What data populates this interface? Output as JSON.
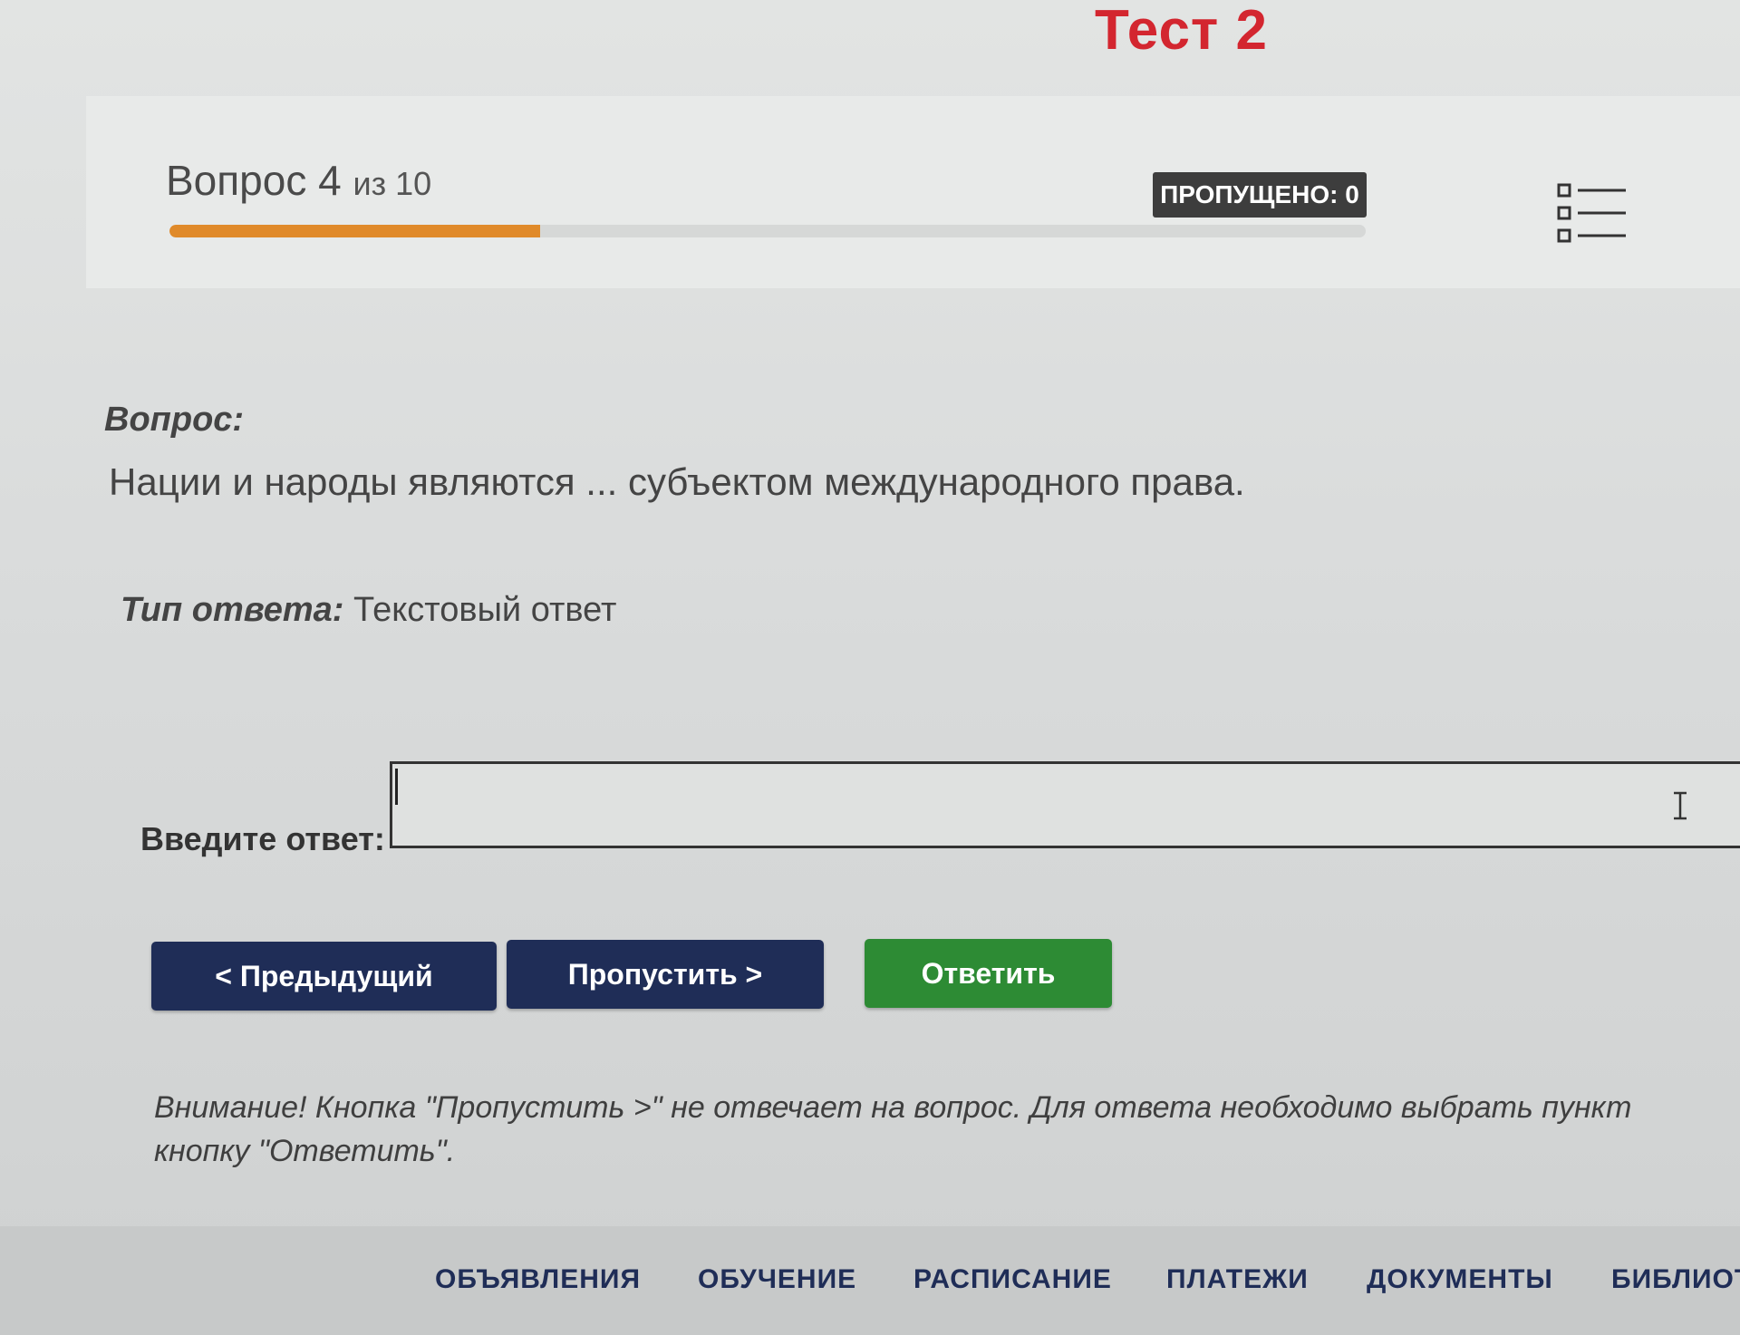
{
  "page": {
    "title": "Тест 2"
  },
  "progress": {
    "counter_prefix": "Вопрос 4",
    "counter_suffix": "из 10",
    "skipped_label": "ПРОПУЩЕНО: 0",
    "completed_fraction": 0.31,
    "fill_color": "#e08a2a",
    "list_icon": "question-list-icon"
  },
  "question": {
    "label": "Вопрос:",
    "text": "Нации и народы являются ... субъектом международного права."
  },
  "answer_type": {
    "label": "Тип ответа:",
    "value": "Текстовый ответ"
  },
  "answer": {
    "label": "Введите ответ:",
    "value": ""
  },
  "buttons": {
    "prev": "< Предыдущий",
    "skip": "Пропустить >",
    "answer": "Ответить",
    "nav_color": "#1f2d57",
    "answer_color": "#2d8b34"
  },
  "warning": {
    "line1": "Внимание! Кнопка \"Пропустить >\" не отвечает на вопрос. Для ответа необходимо выбрать пункт",
    "line2": "кнопку \"Ответить\"."
  },
  "footer_nav": {
    "items": [
      "ОБЪЯВЛЕНИЯ",
      "ОБУЧЕНИЕ",
      "РАСПИСАНИЕ",
      "ПЛАТЕЖИ",
      "ДОКУМЕНТЫ",
      "БИБЛИОТ"
    ]
  },
  "colors": {
    "title": "#d3262f",
    "badge": "#3d3d3d"
  }
}
